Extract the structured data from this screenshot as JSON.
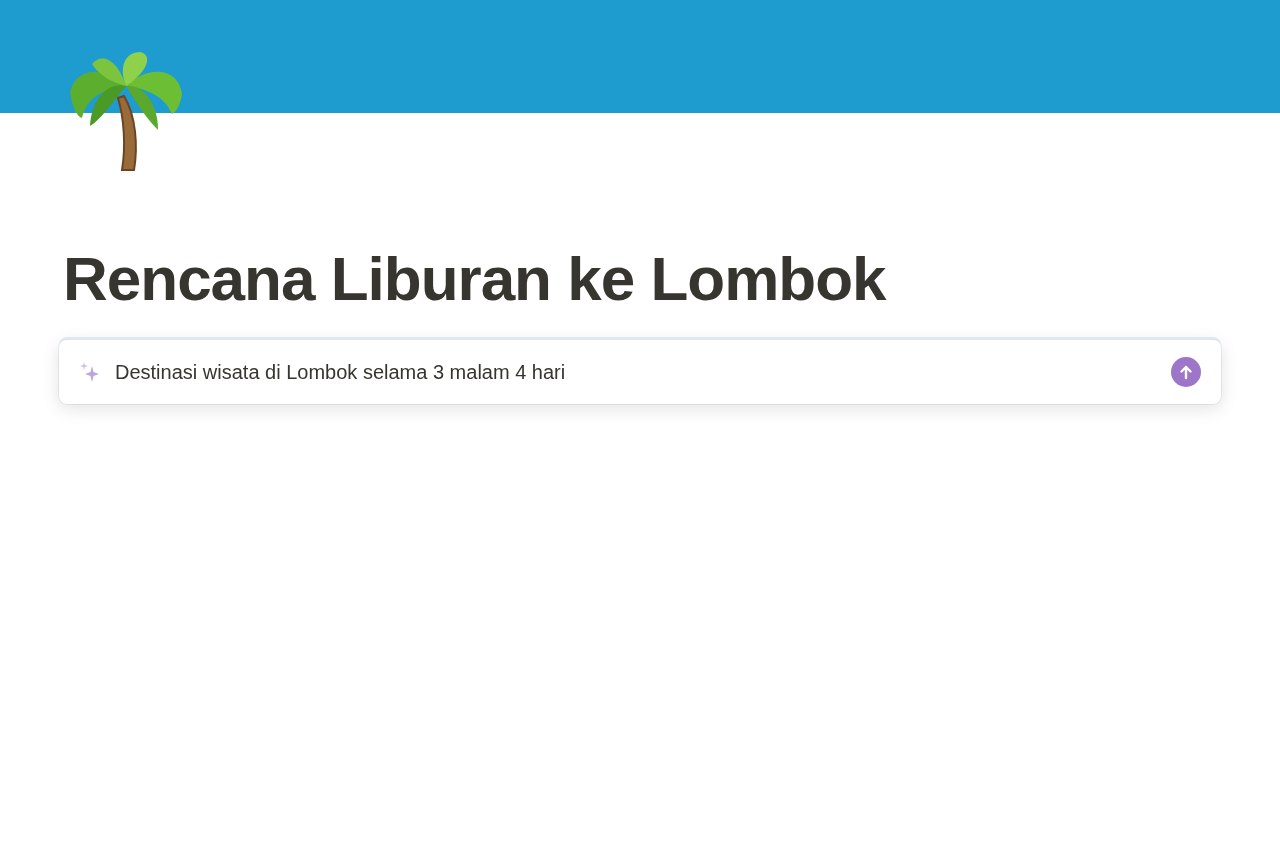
{
  "page": {
    "title": "Rencana Liburan ke Lombok"
  },
  "ai_prompt": {
    "value": "Destinasi wisata di Lombok selama 3 malam 4 hari"
  }
}
